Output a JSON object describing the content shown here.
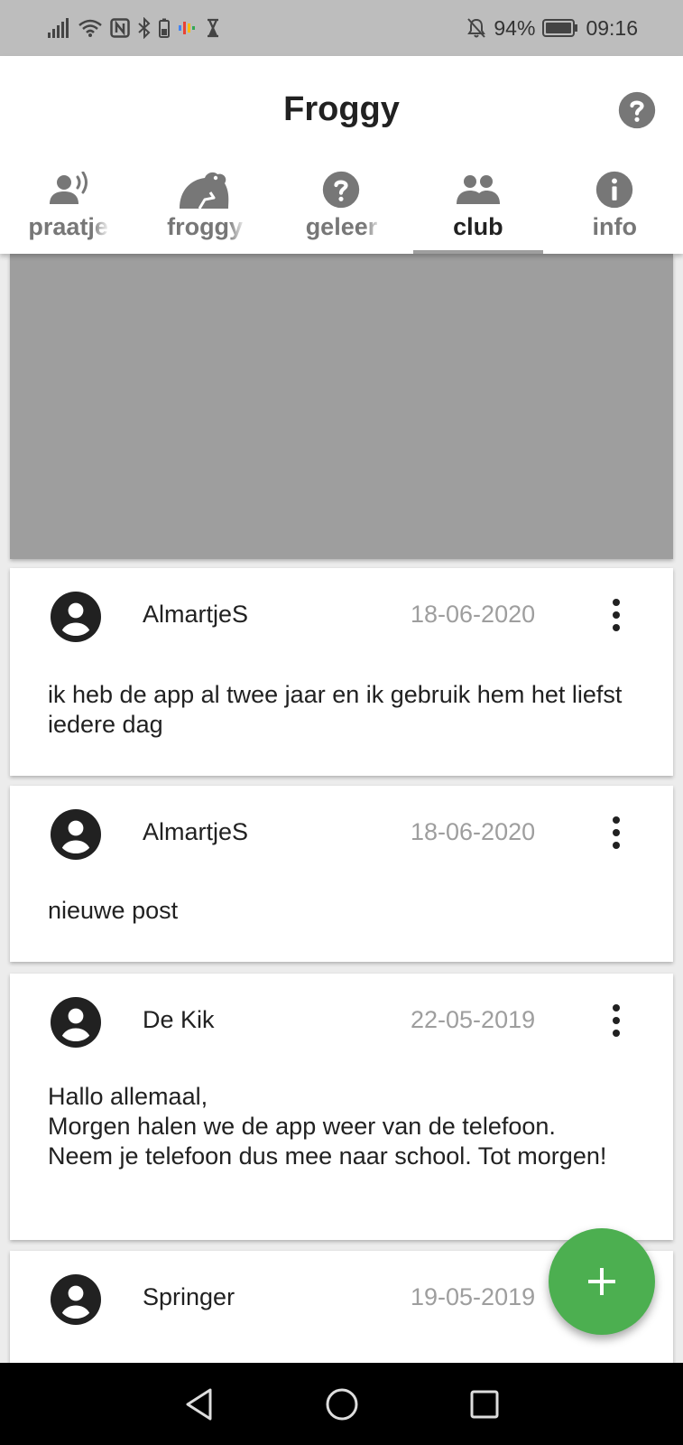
{
  "status_bar": {
    "battery": "94%",
    "time": "09:16",
    "icons": [
      "signal-icon",
      "wifi-icon",
      "nfc-icon",
      "bluetooth-icon",
      "battery-small-icon",
      "app-notification-icon",
      "hourglass-icon",
      "notifications-off-icon",
      "battery-icon"
    ]
  },
  "app_bar": {
    "title": "Froggy",
    "help_icon": "help-icon"
  },
  "tabs": [
    {
      "label": "praatje",
      "icon": "record-voice-icon"
    },
    {
      "label": "froggy",
      "icon": "frog-icon"
    },
    {
      "label": "geleer",
      "icon": "help-icon"
    },
    {
      "label": "club",
      "icon": "people-icon",
      "active": true
    },
    {
      "label": "info",
      "icon": "info-icon"
    }
  ],
  "posts": [
    {
      "author": "AlmartjeS",
      "date": "18-06-2020",
      "text": "ik heb de app al twee jaar en ik gebruik hem het liefst iedere dag"
    },
    {
      "author": "AlmartjeS",
      "date": "18-06-2020",
      "text": "nieuwe post"
    },
    {
      "author": "De Kik",
      "date": "22-05-2019",
      "text": "Hallo allemaal,\nMorgen halen we de app weer van de telefoon. Neem je telefoon dus mee naar school. Tot morgen!"
    },
    {
      "author": "Springer",
      "date": "19-05-2019",
      "text": ""
    }
  ],
  "fab": {
    "icon": "add-icon"
  },
  "nav_bar": {
    "icons": [
      "back-icon",
      "home-icon",
      "recents-icon"
    ]
  },
  "colors": {
    "accent": "#4caf50",
    "status_bar": "#bdbdbd",
    "hero": "#9e9e9e",
    "date": "#9e9e9e"
  }
}
